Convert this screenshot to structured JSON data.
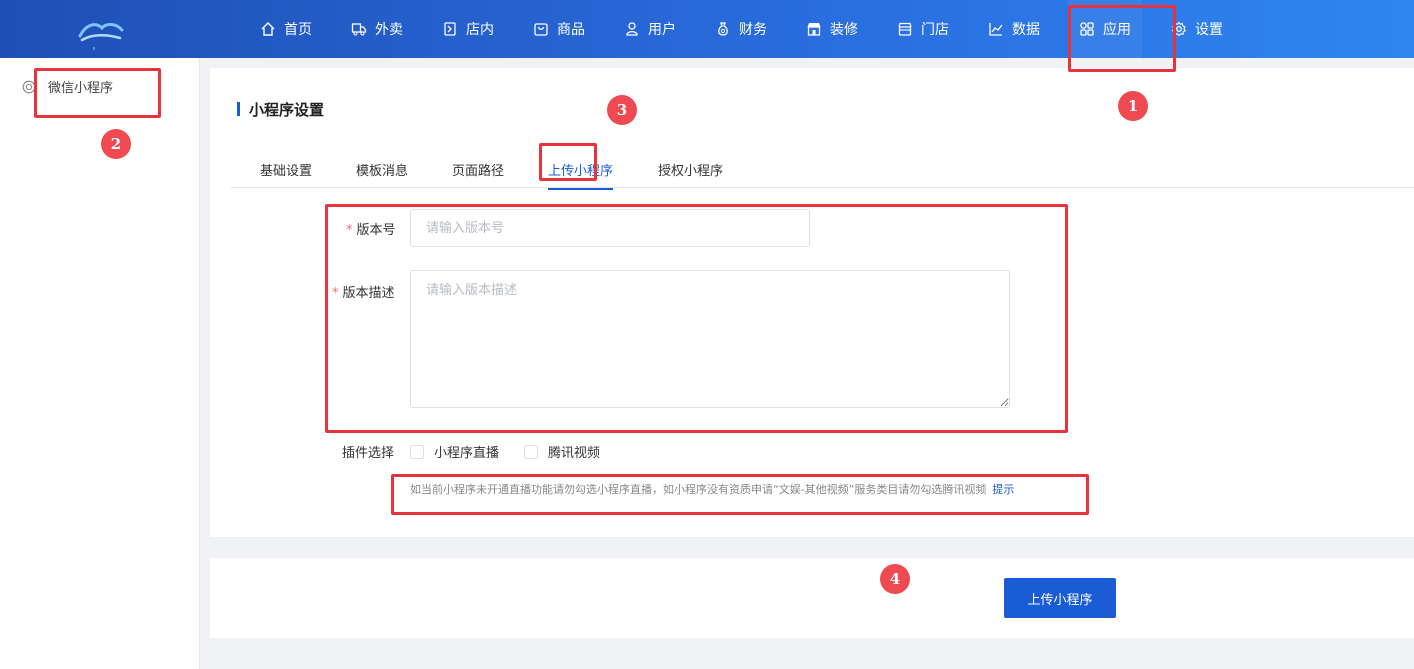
{
  "nav": {
    "items": [
      {
        "label": "首页",
        "icon": "home-icon"
      },
      {
        "label": "外卖",
        "icon": "delivery-icon"
      },
      {
        "label": "店内",
        "icon": "dine-in-icon"
      },
      {
        "label": "商品",
        "icon": "bag-icon"
      },
      {
        "label": "用户",
        "icon": "user-icon"
      },
      {
        "label": "财务",
        "icon": "money-bag-icon"
      },
      {
        "label": "装修",
        "icon": "storefront-icon"
      },
      {
        "label": "门店",
        "icon": "store-icon"
      },
      {
        "label": "数据",
        "icon": "chart-icon"
      },
      {
        "label": "应用",
        "icon": "apps-icon"
      },
      {
        "label": "设置",
        "icon": "gear-icon"
      }
    ],
    "active": "应用"
  },
  "sidebar": {
    "items": [
      {
        "label": "微信小程序",
        "icon": "miniprogram-icon"
      }
    ]
  },
  "main": {
    "title": "小程序设置",
    "tabs": [
      {
        "label": "基础设置"
      },
      {
        "label": "模板消息"
      },
      {
        "label": "页面路径"
      },
      {
        "label": "上传小程序"
      },
      {
        "label": "授权小程序"
      }
    ],
    "active_tab": "上传小程序",
    "form": {
      "version": {
        "label": "版本号",
        "required_mark": "*",
        "placeholder": "请输入版本号",
        "value": ""
      },
      "description": {
        "label": "版本描述",
        "required_mark": "*",
        "placeholder": "请输入版本描述",
        "value": ""
      },
      "plugins": {
        "label": "插件选择",
        "options": [
          {
            "label": "小程序直播",
            "checked": false
          },
          {
            "label": "腾讯视频",
            "checked": false
          }
        ]
      },
      "hint": "如当前小程序未开通直播功能请勿勾选小程序直播，如小程序没有资质申请“文娱-其他视频”服务类目请勿勾选腾讯视频",
      "hint_link": "提示"
    }
  },
  "footer": {
    "upload_button": "上传小程序"
  },
  "annotations": {
    "color": "#e8323c",
    "badge_color": "#ef4a52",
    "numbers": [
      "1",
      "2",
      "3",
      "4"
    ]
  },
  "colors": {
    "primary": "#1a5bd6",
    "nav_gradient_start": "#1f4fb5",
    "nav_gradient_end": "#2f86ef",
    "required": "#f56c6c"
  }
}
